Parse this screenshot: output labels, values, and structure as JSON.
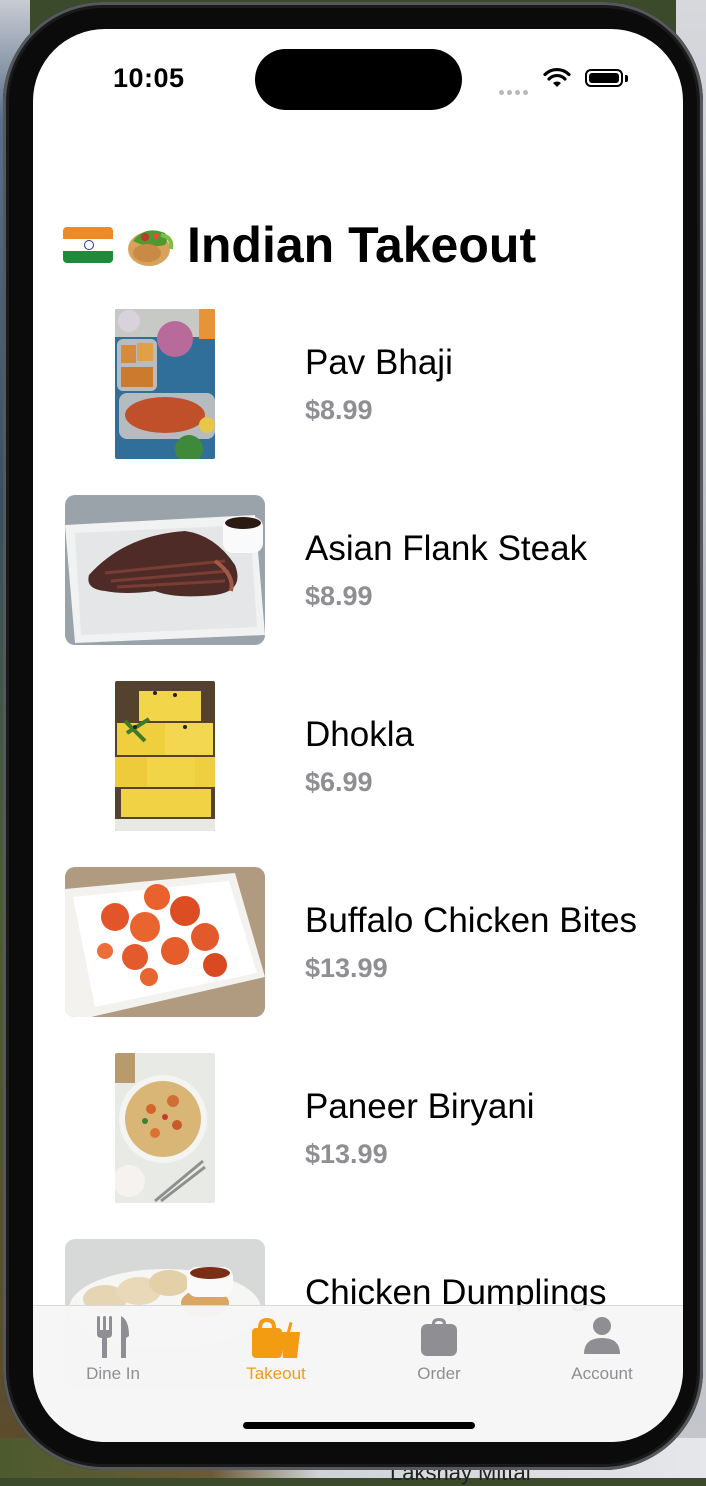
{
  "status_bar": {
    "time": "10:05"
  },
  "page": {
    "title": "Indian Takeout",
    "title_emojis": [
      "india-flag",
      "stuffed-flatbread"
    ]
  },
  "menu_items": [
    {
      "name": "Pav Bhaji",
      "price": "$8.99",
      "image": "pav-bhaji-photo"
    },
    {
      "name": "Asian Flank Steak",
      "price": "$8.99",
      "image": "flank-steak-photo"
    },
    {
      "name": "Dhokla",
      "price": "$6.99",
      "image": "dhokla-photo"
    },
    {
      "name": "Buffalo Chicken Bites",
      "price": "$13.99",
      "image": "chicken-bites-photo"
    },
    {
      "name": "Paneer Biryani",
      "price": "$13.99",
      "image": "paneer-biryani-photo"
    },
    {
      "name": "Chicken Dumplings",
      "price": "",
      "image": "chicken-dumplings-photo"
    }
  ],
  "tab_bar": {
    "tabs": [
      {
        "label": "Dine In",
        "icon": "fork-knife-icon"
      },
      {
        "label": "Takeout",
        "icon": "takeout-bag-icon"
      },
      {
        "label": "Order",
        "icon": "briefcase-icon"
      },
      {
        "label": "Account",
        "icon": "person-icon"
      }
    ],
    "active_tab": "Takeout",
    "active_color": "#f39c12",
    "inactive_color": "#8e8e93"
  },
  "background": {
    "caption": "Lakshay Mittal"
  }
}
